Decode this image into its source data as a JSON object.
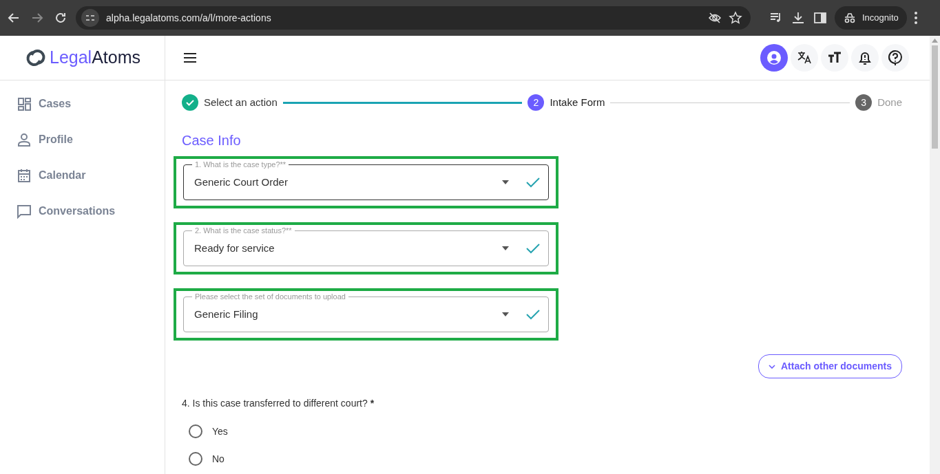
{
  "browser": {
    "url": "alpha.legalatoms.com/a/l/more-actions",
    "profile": "Incognito"
  },
  "logo": {
    "part_1": "Legal",
    "part_2": "Atoms"
  },
  "sidebar": {
    "items": [
      {
        "label": "Cases"
      },
      {
        "label": "Profile"
      },
      {
        "label": "Calendar"
      },
      {
        "label": "Conversations"
      }
    ]
  },
  "header": {
    "buttons": [
      {
        "selected": true
      },
      {
        "selected": false
      },
      {
        "selected": false
      },
      {
        "selected": false
      },
      {
        "selected": false
      }
    ]
  },
  "stepper": [
    {
      "label": "Select an action",
      "completed": true,
      "selected": false
    },
    {
      "label": "Intake Form",
      "number": "2",
      "completed": false,
      "selected": true
    },
    {
      "label": "Done",
      "number": "3",
      "completed": false,
      "selected": false
    }
  ],
  "section_title": "Case Info",
  "fields": [
    {
      "label": "1. What is the case type?**",
      "value": "Generic Court Order",
      "focused": true,
      "valid": true,
      "highlighted": true
    },
    {
      "label": "2. What is the case status?**",
      "value": "Ready for service",
      "focused": false,
      "valid": true,
      "highlighted": true
    },
    {
      "label": "Please select the set of documents to upload",
      "value": "Generic Filing",
      "focused": false,
      "valid": true,
      "highlighted": true
    }
  ],
  "attach_button": "Attach other documents",
  "question": {
    "text": "4. Is this case transferred to different court?",
    "required_mark": "*",
    "options": [
      {
        "label": "Yes",
        "selected": false
      },
      {
        "label": "No",
        "selected": false
      }
    ]
  }
}
